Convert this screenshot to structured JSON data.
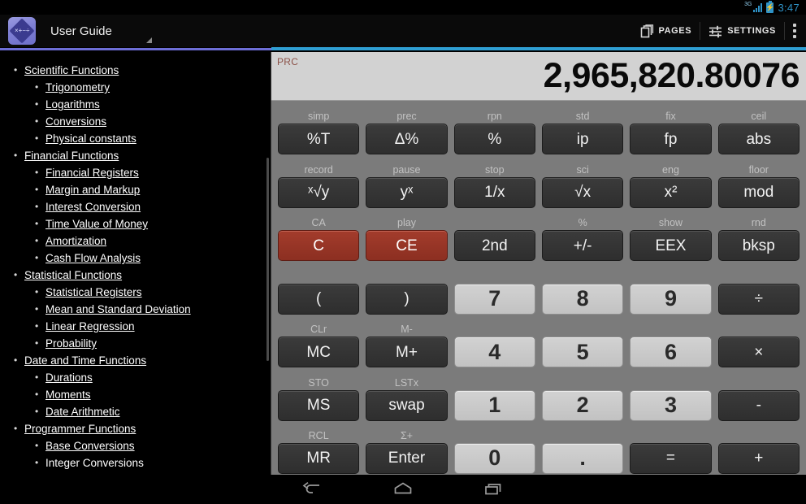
{
  "statusbar": {
    "network_label": "3G",
    "battery_glyph": "⚡",
    "clock": "3:47"
  },
  "actionbar": {
    "app_title": "User Guide",
    "app_icon": "calculator-app-icon",
    "app_icon_ops": "×+−÷",
    "pages_label": "PAGES",
    "settings_label": "SETTINGS",
    "overflow_label": "⋮",
    "accent_color_left": "#6d6ed6",
    "accent_color_right": "#2f9fd4"
  },
  "sidebar": {
    "sections": [
      {
        "label": "Scientific Functions",
        "children": [
          {
            "label": "Trigonometry"
          },
          {
            "label": "Logarithms"
          },
          {
            "label": "Conversions"
          },
          {
            "label": "Physical constants"
          }
        ]
      },
      {
        "label": "Financial Functions",
        "children": [
          {
            "label": "Financial Registers"
          },
          {
            "label": "Margin and Markup"
          },
          {
            "label": "Interest Conversion"
          },
          {
            "label": "Time Value of Money"
          },
          {
            "label": "Amortization"
          },
          {
            "label": "Cash Flow Analysis"
          }
        ]
      },
      {
        "label": "Statistical Functions",
        "children": [
          {
            "label": "Statistical Registers"
          },
          {
            "label": "Mean and Standard Deviation"
          },
          {
            "label": "Linear Regression"
          },
          {
            "label": "Probability"
          }
        ]
      },
      {
        "label": "Date and Time Functions",
        "children": [
          {
            "label": "Durations"
          },
          {
            "label": "Moments"
          },
          {
            "label": "Date Arithmetic"
          }
        ]
      },
      {
        "label": "Programmer Functions",
        "children": [
          {
            "label": "Base Conversions"
          },
          {
            "label": "Integer Conversions"
          }
        ]
      }
    ]
  },
  "calculator": {
    "display": {
      "flag": "PRC",
      "flag_color": "#8c5349",
      "value": "2,965,820.80076"
    },
    "keypad_rows": [
      [
        {
          "shift": "simp",
          "label": "%T",
          "style": "dark"
        },
        {
          "shift": "prec",
          "label": "Δ%",
          "style": "dark"
        },
        {
          "shift": "rpn",
          "label": "%",
          "style": "dark"
        },
        {
          "shift": "std",
          "label": "ip",
          "style": "dark"
        },
        {
          "shift": "fix",
          "label": "fp",
          "style": "dark"
        },
        {
          "shift": "ceil",
          "label": "abs",
          "style": "dark"
        }
      ],
      [
        {
          "shift": "record",
          "label": "ˣ√y",
          "style": "dark"
        },
        {
          "shift": "pause",
          "label": "yˣ",
          "style": "dark"
        },
        {
          "shift": "stop",
          "label": "1/x",
          "style": "dark"
        },
        {
          "shift": "sci",
          "label": "√x",
          "style": "dark"
        },
        {
          "shift": "eng",
          "label": "x²",
          "style": "dark"
        },
        {
          "shift": "floor",
          "label": "mod",
          "style": "dark"
        }
      ],
      [
        {
          "shift": "CA",
          "label": "C",
          "style": "red"
        },
        {
          "shift": "play",
          "label": "CE",
          "style": "red"
        },
        {
          "shift": "",
          "label": "2nd",
          "style": "dark"
        },
        {
          "shift": "%",
          "label": "+/-",
          "style": "dark"
        },
        {
          "shift": "show",
          "label": "EEX",
          "style": "dark"
        },
        {
          "shift": "rnd",
          "label": "bksp",
          "style": "dark"
        }
      ],
      [
        {
          "shift": "",
          "label": "(",
          "style": "dark"
        },
        {
          "shift": "",
          "label": ")",
          "style": "dark"
        },
        {
          "shift": "",
          "label": "7",
          "style": "light"
        },
        {
          "shift": "",
          "label": "8",
          "style": "light"
        },
        {
          "shift": "",
          "label": "9",
          "style": "light"
        },
        {
          "shift": "",
          "label": "÷",
          "style": "dark"
        }
      ],
      [
        {
          "shift": "CLr",
          "label": "MC",
          "style": "dark"
        },
        {
          "shift": "M-",
          "label": "M+",
          "style": "dark"
        },
        {
          "shift": "",
          "label": "4",
          "style": "light"
        },
        {
          "shift": "",
          "label": "5",
          "style": "light"
        },
        {
          "shift": "",
          "label": "6",
          "style": "light"
        },
        {
          "shift": "",
          "label": "×",
          "style": "dark"
        }
      ],
      [
        {
          "shift": "STO",
          "label": "MS",
          "style": "dark"
        },
        {
          "shift": "LSTx",
          "label": "swap",
          "style": "dark"
        },
        {
          "shift": "",
          "label": "1",
          "style": "light"
        },
        {
          "shift": "",
          "label": "2",
          "style": "light"
        },
        {
          "shift": "",
          "label": "3",
          "style": "light"
        },
        {
          "shift": "",
          "label": "-",
          "style": "dark"
        }
      ],
      [
        {
          "shift": "RCL",
          "label": "MR",
          "style": "dark"
        },
        {
          "shift": "Σ+",
          "label": "Enter",
          "style": "dark"
        },
        {
          "shift": "",
          "label": "0",
          "style": "light"
        },
        {
          "shift": "",
          "label": ".",
          "style": "light"
        },
        {
          "shift": "",
          "label": "=",
          "style": "dark"
        },
        {
          "shift": "",
          "label": "+",
          "style": "dark"
        }
      ]
    ]
  },
  "navbar": {
    "back_label": "back-icon",
    "home_label": "home-icon",
    "recents_label": "recents-icon"
  }
}
